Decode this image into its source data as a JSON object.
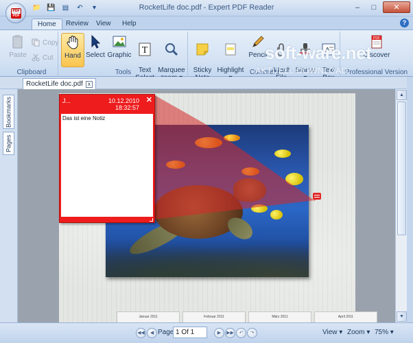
{
  "window": {
    "title": "RocketLife doc.pdf - Expert PDF Reader",
    "controls": {
      "minimize": "–",
      "maximize": "□",
      "close": "✕"
    }
  },
  "app_orb": {
    "badge_top": "PDF",
    "badge_bottom": "PDF"
  },
  "ribbon_tabs": [
    "Home",
    "Review",
    "View",
    "Help"
  ],
  "ribbon": {
    "clipboard": {
      "label": "Clipboard",
      "paste": "Paste",
      "copy": "Copy",
      "cut": "Cut"
    },
    "tools": {
      "label": "Tools",
      "hand": "Hand",
      "select": "Select",
      "graphic": "Graphic",
      "text_select": "Text\nSelect",
      "marquee_zoom": "Marquee\nzoom ▾"
    },
    "comment": {
      "label": "Comment",
      "sticky_note": "Sticky\nNote",
      "highlight": "Highlight\n▾",
      "pencil": "Pencil",
      "attach_file": "Attach\nFile",
      "stamp": "Stamp\n▾",
      "text_box": "Text\nBox"
    },
    "professional": {
      "label": "Professional Version",
      "discover": "Discover"
    }
  },
  "watermark": {
    "main": "soft-ware.net",
    "sub": "AKTUELL DOWNLOAD"
  },
  "document_tab": {
    "name": "RocketLife doc.pdf",
    "close": "x"
  },
  "side_tabs": [
    "Bookmarks",
    "Pages"
  ],
  "sticky_note": {
    "author": "J...",
    "date": "10.12.2010",
    "time": "18:32:57",
    "close": "✕",
    "text": "Das ist eine Notiz"
  },
  "calendars": [
    "Januar 2011",
    "Februar 2011",
    "März 2011",
    "April 2011"
  ],
  "statusbar": {
    "page_label": "Page",
    "page_value": "1 Of 1",
    "view": "View ▾",
    "zoom": "Zoom ▾",
    "zoom_level": "75% ▾"
  },
  "colors": {
    "note_red": "#ee1c1c",
    "ribbon_bg": "#d2e1f3",
    "active_tool": "#f9c54e"
  }
}
